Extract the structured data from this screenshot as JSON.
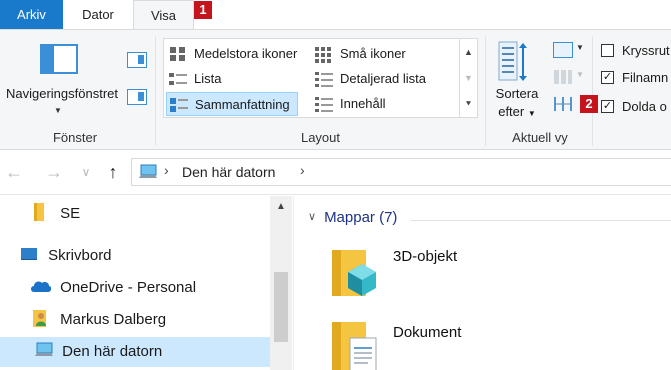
{
  "tabs": [
    {
      "label": "Arkiv"
    },
    {
      "label": "Dator"
    },
    {
      "label": "Visa"
    }
  ],
  "badges": {
    "one": "1",
    "two": "2"
  },
  "ribbon": {
    "panes": {
      "nav_pane_label": "Navigeringsfönstret",
      "group_label": "Fönster"
    },
    "layout": {
      "items": [
        {
          "label": "Medelstora ikoner"
        },
        {
          "label": "Små ikoner"
        },
        {
          "label": "Lista"
        },
        {
          "label": "Detaljerad lista"
        },
        {
          "label": "Sammanfattning",
          "selected": true
        },
        {
          "label": "Innehåll"
        }
      ],
      "group_label": "Layout"
    },
    "current_view": {
      "sort_label_1": "Sortera",
      "sort_label_2": "efter",
      "group_label": "Aktuell vy"
    },
    "show_hide": {
      "checkboxes": [
        {
          "label": "Kryssrut",
          "checked": false
        },
        {
          "label": "Filnamn",
          "checked": true
        },
        {
          "label": "Dolda o",
          "checked": true
        }
      ]
    }
  },
  "address": {
    "path": "Den här datorn"
  },
  "navpane": {
    "items": [
      {
        "label": "SE"
      },
      {
        "label": "Skrivbord"
      },
      {
        "label": "OneDrive - Personal"
      },
      {
        "label": "Markus Dalberg"
      },
      {
        "label": "Den här datorn",
        "selected": true
      }
    ]
  },
  "content": {
    "section_header": "Mappar (7)",
    "folders": [
      {
        "label": "3D-objekt"
      },
      {
        "label": "Dokument"
      }
    ]
  },
  "colors": {
    "accent": "#1979ca",
    "badge": "#c4151c",
    "selection": "#cce8ff",
    "header_text": "#1e3287"
  }
}
